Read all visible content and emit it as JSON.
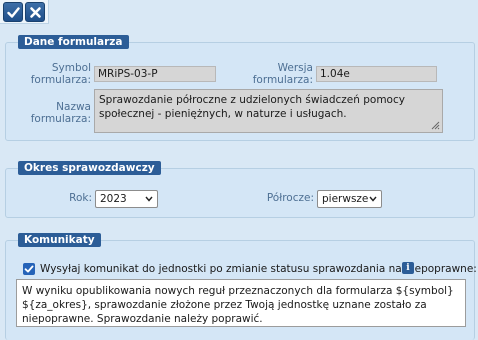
{
  "toolbar": {
    "ok_icon": "check-icon",
    "cancel_icon": "close-icon"
  },
  "form_data": {
    "legend": "Dane formularza",
    "symbol_label_1": "Symbol",
    "symbol_label_2": "formularza:",
    "symbol_value": "MRiPS-03-P",
    "version_label_1": "Wersja",
    "version_label_2": "formularza:",
    "version_value": "1.04e",
    "name_label_1": "Nazwa",
    "name_label_2": "formularza:",
    "name_value": "Sprawozdanie półroczne z udzielonych świadczeń pomocy społecznej - pieniężnych, w naturze i usługach."
  },
  "period": {
    "legend": "Okres sprawozdawczy",
    "year_label": "Rok:",
    "year_value": "2023",
    "half_label": "Półrocze:",
    "half_value": "pierwsze"
  },
  "messages": {
    "legend": "Komunikaty",
    "checkbox_checked": true,
    "checkbox_label": "Wysyłaj komunikat do jednostki po zmianie statusu sprawozdania na niepoprawne:",
    "info_icon": "info-icon",
    "message_text": "W wyniku opublikowania nowych reguł przeznaczonych dla formularza ${symbol} ${za_okres}, sprawozdanie złożone przez Twoją jednostkę uznane zostało za niepoprawne. Sprawozdanie należy poprawić."
  }
}
